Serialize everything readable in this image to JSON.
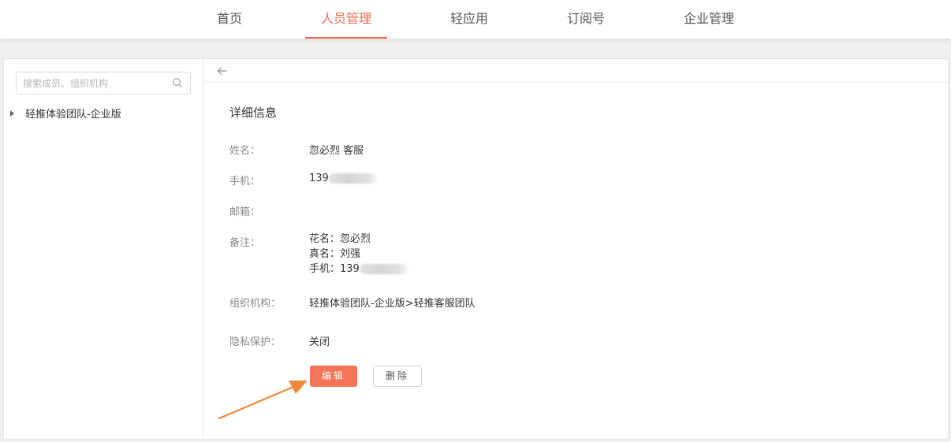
{
  "nav": {
    "tabs": [
      {
        "label": "首页"
      },
      {
        "label": "人员管理"
      },
      {
        "label": "轻应用"
      },
      {
        "label": "订阅号"
      },
      {
        "label": "企业管理"
      }
    ],
    "active_tab": "人员管理"
  },
  "sidebar": {
    "search_placeholder": "搜索成员、组织机构",
    "tree": [
      {
        "label": "轻推体验团队-企业版"
      }
    ]
  },
  "detail": {
    "title": "详细信息",
    "fields": {
      "name_label": "姓名：",
      "name_value": "忽必烈 客服",
      "phone_label": "手机：",
      "phone_value": "139",
      "email_label": "邮箱：",
      "email_value": "",
      "note_label": "备注：",
      "note_lines": [
        "花名：忽必烈",
        "真名：刘强",
        "手机：139"
      ],
      "org_label": "组织机构：",
      "org_value": "轻推体验团队-企业版>轻推客服团队",
      "privacy_label": "隐私保护：",
      "privacy_value": "关闭"
    },
    "buttons": {
      "edit": "编辑",
      "delete": "删除"
    }
  },
  "colors": {
    "accent": "#f26b50",
    "edit_button": "#f47458",
    "annotation_arrow": "#f4883a"
  },
  "icons": {
    "search": "search-icon",
    "back": "back-arrow-icon",
    "tree_expand": "caret-right-icon"
  }
}
